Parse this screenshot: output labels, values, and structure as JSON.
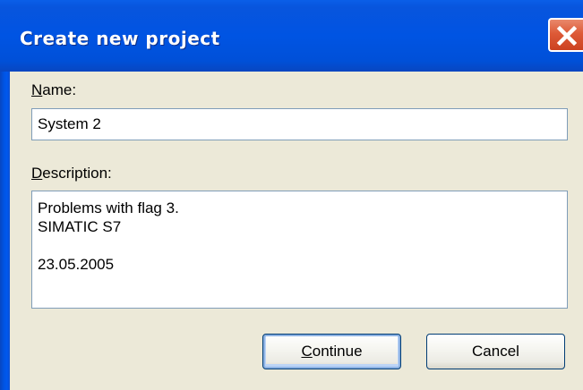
{
  "dialog": {
    "title": "Create new project",
    "close_icon": "close-icon",
    "accent_color": "#0054e3",
    "close_color": "#dd5a37"
  },
  "form": {
    "name_label_mnemonic": "N",
    "name_label_rest": "ame:",
    "name_value": "System 2",
    "description_label_mnemonic": "D",
    "description_label_rest": "escription:",
    "description_lines": [
      "Problems with flag 3.",
      "SIMATIC S7",
      "",
      "23.05.2005"
    ]
  },
  "buttons": {
    "continue_mnemonic": "C",
    "continue_rest": "ontinue",
    "cancel_label": "Cancel"
  }
}
